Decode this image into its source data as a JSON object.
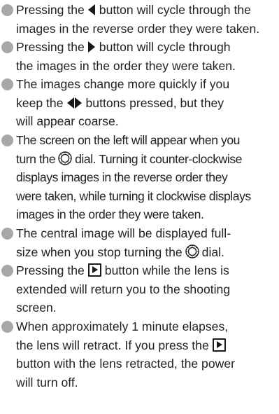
{
  "items": [
    {
      "l1a": "Pressing the",
      "l1b": "button will cycle through the",
      "l2": "images in the reverse order they were taken."
    },
    {
      "l1a": "Pressing the",
      "l1b": "button will cycle through",
      "l2": "the images in the order they were taken."
    },
    {
      "l1": "The images change more quickly if you",
      "l2a": "keep the",
      "l2b": "buttons pressed, but they",
      "l3": "will appear coarse."
    },
    {
      "l1": "The screen on the left will appear when you",
      "l2a": "turn the",
      "l2b": "dial. Turning it counter-clockwise",
      "l3": "displays images in the reverse order they",
      "l4": "were taken, while turning it clockwise displays",
      "l5": "images in the order they were taken."
    },
    {
      "l1": "The central image will be displayed full-",
      "l2a": "size when you stop turning the",
      "l2b": "dial."
    },
    {
      "l1a": "Pressing the",
      "l1b": "button while the lens is",
      "l2": "extended will return you to the shooting",
      "l3": "screen."
    },
    {
      "l1": "When approximately 1 minute elapses,",
      "l2a": "the lens will retract. If you press the",
      "l3": "button with the lens retracted, the power",
      "l4": "will turn off."
    }
  ],
  "icons": {
    "left_button": "left-arrow-button-icon",
    "right_button": "right-arrow-button-icon",
    "dial": "control-dial-icon",
    "playback": "playback-button-icon"
  }
}
